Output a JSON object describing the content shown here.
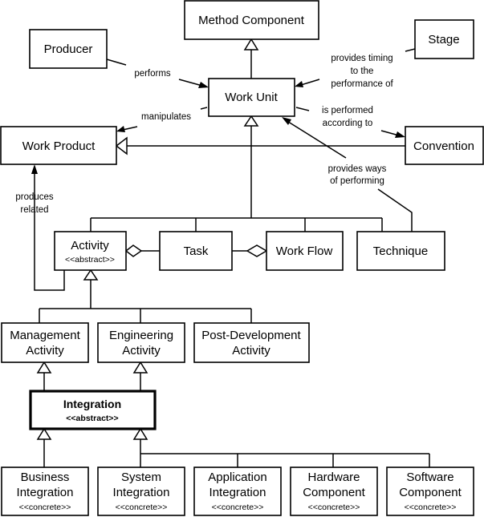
{
  "boxes": {
    "method_component": "Method Component",
    "producer": "Producer",
    "stage": "Stage",
    "work_unit": "Work Unit",
    "work_product": "Work Product",
    "convention": "Convention",
    "activity": [
      "Activity",
      "<<abstract>>"
    ],
    "task": "Task",
    "work_flow": "Work Flow",
    "technique": "Technique",
    "management_activity": [
      "Management",
      "Activity"
    ],
    "engineering_activity": [
      "Engineering",
      "Activity"
    ],
    "post_development_activity": [
      "Post-Development",
      "Activity"
    ],
    "integration": [
      "Integration",
      "<<abstract>>"
    ],
    "business_integration": [
      "Business",
      "Integration",
      "<<concrete>>"
    ],
    "system_integration": [
      "System",
      "Integration",
      "<<concrete>>"
    ],
    "application_integration": [
      "Application",
      "Integration",
      "<<concrete>>"
    ],
    "hardware_component": [
      "Hardware",
      "Component",
      "<<concrete>>"
    ],
    "software_component": [
      "Software",
      "Component",
      "<<concrete>>"
    ]
  },
  "associations": {
    "performs": "performs",
    "timing": [
      "provides timing",
      "to the",
      "performance of"
    ],
    "manipulates": "manipulates",
    "performed_according": [
      "is performed",
      "according to"
    ],
    "ways": [
      "provides ways",
      "of performing"
    ],
    "produces": [
      "produces",
      "related"
    ]
  }
}
